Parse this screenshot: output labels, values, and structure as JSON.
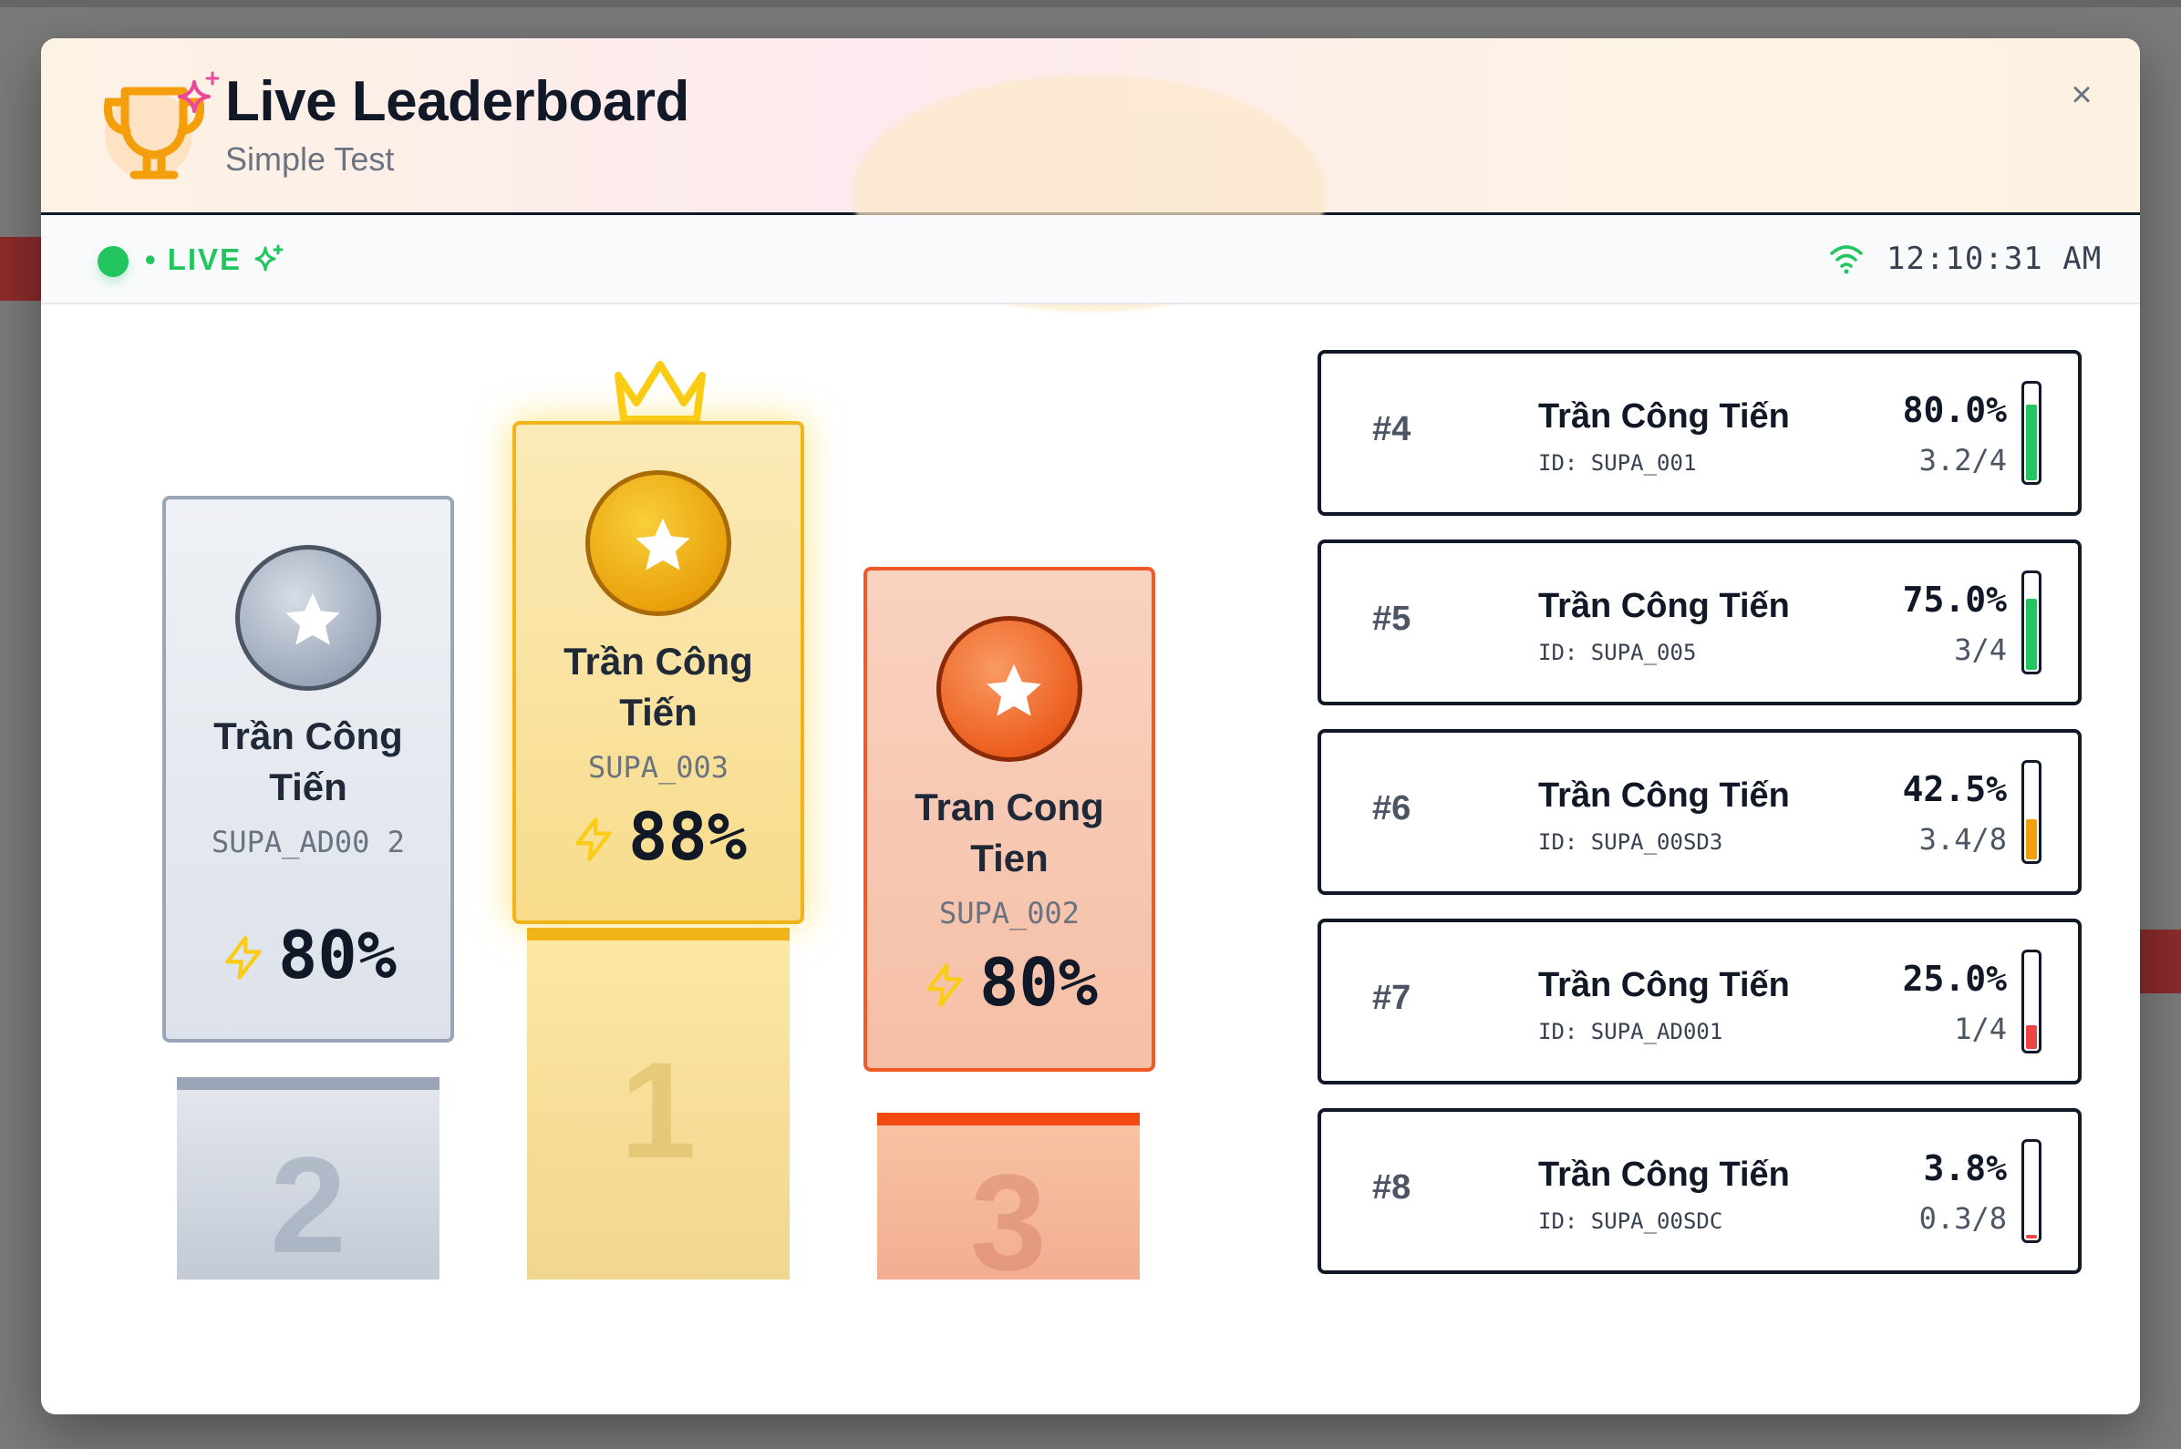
{
  "header": {
    "title": "Live Leaderboard",
    "subtitle": "Simple Test",
    "close_label": "×"
  },
  "status": {
    "live_label": "• LIVE",
    "time": "12:10:31 AM"
  },
  "podium": {
    "first": {
      "rank_number": "1",
      "name": "Trần Công Tiến",
      "id": "SUPA_003",
      "score": "88%"
    },
    "second": {
      "rank_number": "2",
      "name": "Trần Công Tiến",
      "id": "SUPA_AD00 2",
      "score": "80%"
    },
    "third": {
      "rank_number": "3",
      "name": "Tran Cong Tien",
      "id": "SUPA_002",
      "score": "80%"
    }
  },
  "rankings": [
    {
      "rank": "#4",
      "name": "Trần Công Tiến",
      "id": "ID: SUPA_001",
      "percent": "80.0%",
      "fraction": "3.2/4",
      "fill": 0.8,
      "color": "#22c55e"
    },
    {
      "rank": "#5",
      "name": "Trần Công Tiến",
      "id": "ID: SUPA_005",
      "percent": "75.0%",
      "fraction": "3/4",
      "fill": 0.75,
      "color": "#22c55e"
    },
    {
      "rank": "#6",
      "name": "Trần Công Tiến",
      "id": "ID: SUPA_00SD3",
      "percent": "42.5%",
      "fraction": "3.4/8",
      "fill": 0.425,
      "color": "#f59e0b"
    },
    {
      "rank": "#7",
      "name": "Trần Công Tiến",
      "id": "ID: SUPA_AD001",
      "percent": "25.0%",
      "fraction": "1/4",
      "fill": 0.25,
      "color": "#ef4444"
    },
    {
      "rank": "#8",
      "name": "Trần Công Tiến",
      "id": "ID: SUPA_00SDC",
      "percent": "3.8%",
      "fraction": "0.3/8",
      "fill": 0.038,
      "color": "#ef4444"
    }
  ],
  "colors": {
    "gold": "#f0b419",
    "silver": "#9aa6b8",
    "bronze": "#f05a28",
    "live_green": "#22c55e"
  },
  "icons": {
    "header": "trophy-icon",
    "live": "sparkle-icon",
    "connection": "wifi-icon",
    "avatar": "star-icon",
    "score": "lightning-icon",
    "winner": "crown-icon"
  }
}
